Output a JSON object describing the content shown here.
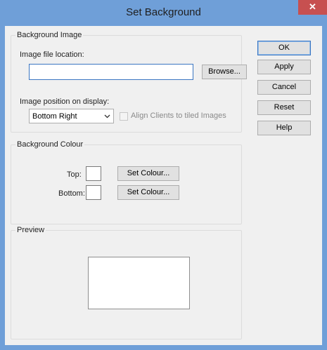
{
  "window": {
    "title": "Set Background",
    "close_glyph": "✕"
  },
  "image_group": {
    "label": "Background Image",
    "file_location_label": "Image file location:",
    "file_location_value": "",
    "browse_label": "Browse...",
    "position_label": "Image position on display:",
    "position_value": "Bottom Right",
    "align_label": "Align Clients to tiled Images",
    "align_checked": false
  },
  "colour_group": {
    "label": "Background Colour",
    "top_label": "Top:",
    "bottom_label": "Bottom:",
    "top_colour": "#ffffff",
    "bottom_colour": "#ffffff",
    "set_colour_label_top": "Set Colour...",
    "set_colour_label_bottom": "Set Colour..."
  },
  "preview_group": {
    "label": "Preview"
  },
  "buttons": {
    "ok": "OK",
    "apply": "Apply",
    "cancel": "Cancel",
    "reset": "Reset",
    "help": "Help"
  },
  "icons": {
    "close": "close-icon",
    "dropdown": "chevron-down-icon"
  }
}
